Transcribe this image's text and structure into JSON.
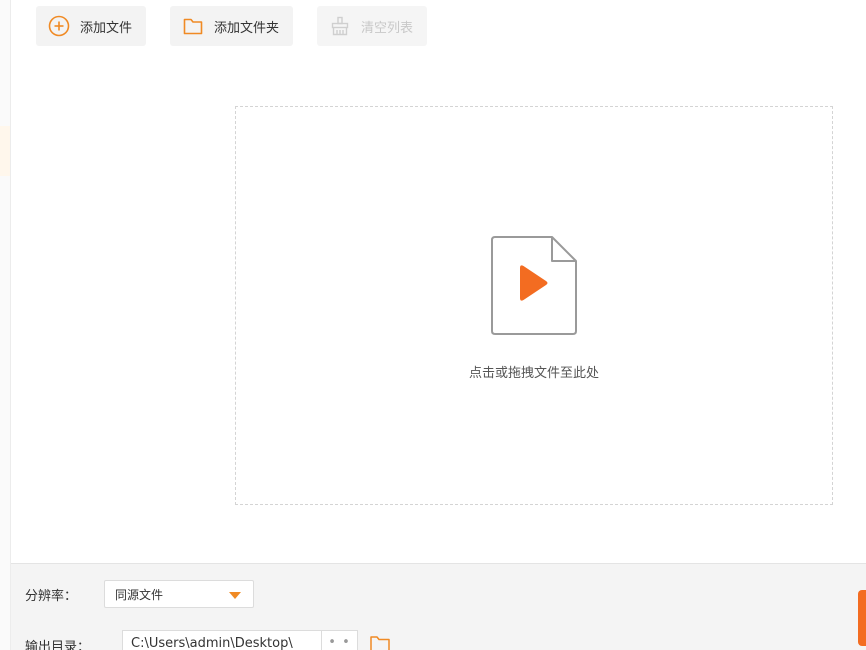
{
  "toolbar": {
    "add_file": {
      "label": "添加文件",
      "icon": "plus-circle-icon",
      "color": "#f08a24"
    },
    "add_folder": {
      "label": "添加文件夹",
      "icon": "folder-icon",
      "color": "#f08a24"
    },
    "clear_list": {
      "label": "清空列表",
      "icon": "broom-icon",
      "disabled": true
    }
  },
  "drop_zone": {
    "hint": "点击或拖拽文件至此处",
    "icon": "video-file-icon",
    "play_color": "#f36c21"
  },
  "settings": {
    "resolution_label": "分辨率：",
    "resolution_value": "同源文件",
    "output_label": "输出目录：",
    "output_path": "C:\\Users\\admin\\Desktop\\",
    "more_label": "• • •"
  },
  "accent_color": "#f36c21"
}
